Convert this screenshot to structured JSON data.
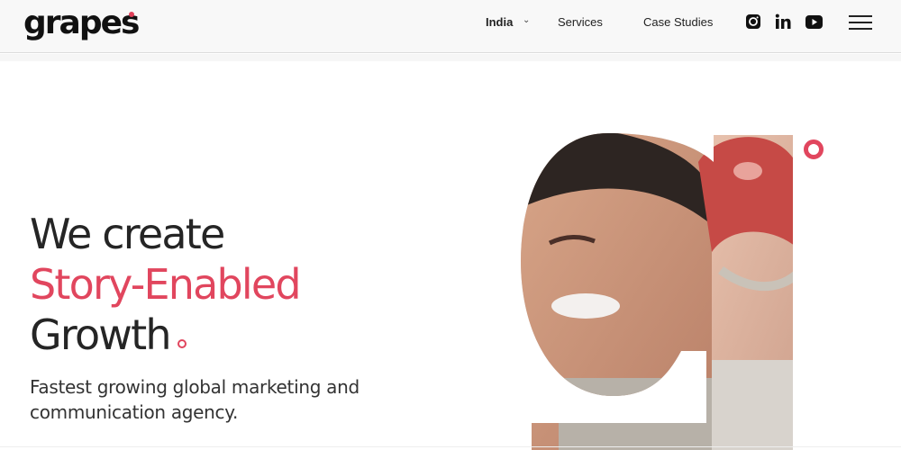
{
  "header": {
    "logo": "grapes",
    "nav": {
      "country": "India",
      "services": "Services",
      "case_studies": "Case Studies"
    },
    "social_icons": [
      "instagram-icon",
      "linkedin-icon",
      "youtube-icon"
    ],
    "menu_icon": "hamburger-menu-icon"
  },
  "hero": {
    "line1": "We create",
    "line2": "Story-Enabled",
    "line3": "Growth",
    "subtitle": "Fastest growing global marketing and communication agency.",
    "image": "g-shaped photo of two smiling people wearing helmets"
  },
  "colors": {
    "accent": "#e1465e",
    "text": "#252525",
    "header_bg": "#f8f8f8"
  }
}
